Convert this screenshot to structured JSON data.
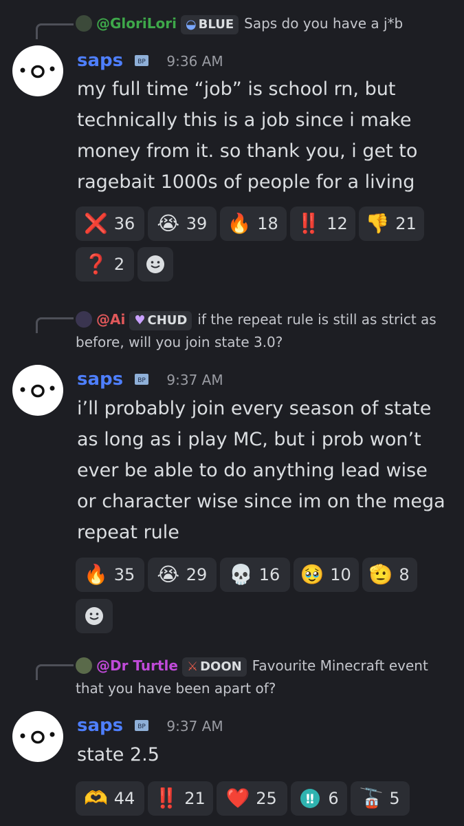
{
  "messages": [
    {
      "reply": {
        "name": "@GloriLori",
        "name_color": "#3ea84a",
        "tag": "BLUE",
        "tag_icon": "blue-ring-icon",
        "text": "Saps do you have a j*b"
      },
      "author": "saps",
      "time": "9:36 AM",
      "content": "my full time “job” is school rn, but technically this is a job since i make money from it. so thank you, i get to ragebait 1000s of people for a living",
      "reactions": [
        {
          "emoji": "❌",
          "count": "36",
          "icon": "cross-mark-icon"
        },
        {
          "emoji": "😭",
          "count": "39",
          "icon": "crying-face-icon"
        },
        {
          "emoji": "🔥",
          "count": "18",
          "icon": "fire-icon"
        },
        {
          "emoji": "‼️",
          "count": "12",
          "icon": "double-exclamation-icon"
        },
        {
          "emoji": "👎",
          "count": "21",
          "icon": "thumbs-down-icon"
        },
        {
          "emoji": "❓",
          "count": "2",
          "icon": "question-mark-icon"
        }
      ]
    },
    {
      "reply": {
        "name": "@Ai",
        "name_color": "#e0585a",
        "tag": "CHUD",
        "tag_icon": "purple-heart-icon",
        "text": "if the repeat rule is still as strict as before, will you join state 3.0?"
      },
      "author": "saps",
      "time": "9:37 AM",
      "content": "i’ll probably join every season of state as long as i play MC, but i prob won’t ever be able to do anything lead wise or character wise since im on the mega repeat rule",
      "reactions": [
        {
          "emoji": "🔥",
          "count": "35",
          "icon": "fire-icon"
        },
        {
          "emoji": "😭",
          "count": "29",
          "icon": "crying-face-icon"
        },
        {
          "emoji": "💀",
          "count": "16",
          "icon": "skull-icon"
        },
        {
          "emoji": "🥹",
          "count": "10",
          "icon": "holding-back-tears-icon"
        },
        {
          "emoji": "🫡",
          "count": "8",
          "icon": "saluting-face-icon"
        }
      ]
    },
    {
      "reply": {
        "name": "@Dr Turtle",
        "name_color": "#c04ad9",
        "tag": "DOON",
        "tag_icon": "sword-icon",
        "text": "Favourite Minecraft event that you have been apart of?"
      },
      "author": "saps",
      "time": "9:37 AM",
      "content": "state 2.5",
      "reactions": [
        {
          "emoji": "🫶",
          "count": "44",
          "icon": "heart-hands-icon"
        },
        {
          "emoji": "‼️",
          "count": "21",
          "icon": "double-exclamation-icon"
        },
        {
          "emoji": "❤️",
          "count": "25",
          "icon": "red-heart-icon"
        },
        {
          "emoji": "‼",
          "count": "6",
          "icon": "exclamation-button-icon"
        },
        {
          "emoji": "🚡",
          "count": "5",
          "icon": "tram-icon"
        }
      ]
    }
  ]
}
